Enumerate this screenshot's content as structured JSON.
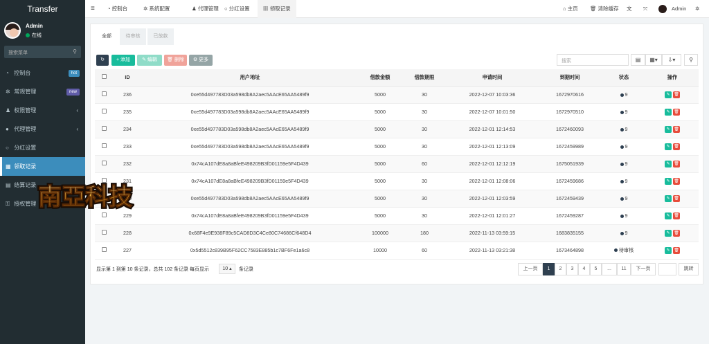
{
  "app": {
    "brand": "Transfer"
  },
  "user": {
    "name": "Admin",
    "status": "在线"
  },
  "sidebar": {
    "search_placeholder": "搜索菜单",
    "items": [
      {
        "label": "控制台",
        "badge": "hot",
        "badge_color": "#3c8dbc",
        "icon": "dashboard-icon"
      },
      {
        "label": "常规管理",
        "badge": "new",
        "badge_color": "#605ca8",
        "icon": "cogs-icon"
      },
      {
        "label": "权限管理",
        "chevron": "‹",
        "icon": "users-icon"
      },
      {
        "label": "代理管理",
        "chevron": "‹",
        "icon": "user-circle-icon"
      },
      {
        "label": "分红设置",
        "icon": "circle-icon"
      },
      {
        "label": "领取记录",
        "icon": "table-icon",
        "active": true
      },
      {
        "label": "结算记录",
        "icon": "list-icon"
      },
      {
        "label": "授权管理",
        "icon": "key-icon"
      }
    ]
  },
  "topbar": {
    "menu_icon": "≡",
    "tabs": [
      {
        "label": "控制台",
        "icon": "dashboard-icon"
      },
      {
        "label": "系统配置",
        "icon": "gear-icon"
      },
      {
        "label": "代理管理",
        "icon": "user-icon"
      },
      {
        "label": "分红设置",
        "icon": "circle-icon"
      },
      {
        "label": "领取记录",
        "icon": "table-icon",
        "active": true
      }
    ],
    "home": "主页",
    "clear_cache": "清除缓存",
    "username": "Admin"
  },
  "content_tabs": [
    "全部",
    "待审核",
    "已放款"
  ],
  "toolbar": {
    "refresh": "↻",
    "add": "+ 添加",
    "edit": "✎ 编辑",
    "delete": "🗑 删除",
    "more": "⚙ 更多",
    "search_placeholder": "搜索"
  },
  "table": {
    "headers": [
      "",
      "ID",
      "用户地址",
      "借款金额",
      "借款期限",
      "申请时间",
      "到期时间",
      "状态",
      "操作"
    ],
    "rows": [
      {
        "id": "236",
        "addr": "0xe55d497783D03a598db8A2aec5AAcE65AA5489f9",
        "amount": "5000",
        "term": "30",
        "apply": "2022-12-07 10:03:36",
        "due": "1672970616",
        "status": "9"
      },
      {
        "id": "235",
        "addr": "0xe55d497783D03a598db8A2aec5AAcE65AA5489f9",
        "amount": "5000",
        "term": "30",
        "apply": "2022-12-07 10:01:50",
        "due": "1672970510",
        "status": "9"
      },
      {
        "id": "234",
        "addr": "0xe55d497783D03a598db8A2aec5AAcE65AA5489f9",
        "amount": "5000",
        "term": "30",
        "apply": "2022-12-01 12:14:53",
        "due": "1672460093",
        "status": "9"
      },
      {
        "id": "233",
        "addr": "0xe55d497783D03a598db8A2aec5AAcE65AA5489f9",
        "amount": "5000",
        "term": "30",
        "apply": "2022-12-01 12:13:09",
        "due": "1672459989",
        "status": "9"
      },
      {
        "id": "232",
        "addr": "0x74cA107dE8a8aBfeE498209B3fD01159e5F4D439",
        "amount": "5000",
        "term": "60",
        "apply": "2022-12-01 12:12:19",
        "due": "1675051939",
        "status": "9"
      },
      {
        "id": "231",
        "addr": "0x74cA107dE8a8aBfeE498209B3fD01159e5F4D439",
        "amount": "5000",
        "term": "30",
        "apply": "2022-12-01 12:08:06",
        "due": "1672459686",
        "status": "9"
      },
      {
        "id": "230",
        "addr": "0xe55d497783D03a598db8A2aec5AAcE65AA5489f9",
        "amount": "5000",
        "term": "30",
        "apply": "2022-12-01 12:03:59",
        "due": "1672459439",
        "status": "9"
      },
      {
        "id": "229",
        "addr": "0x74cA107dE8a8aBfeE498209B3fD01159e5F4D439",
        "amount": "5000",
        "term": "30",
        "apply": "2022-12-01 12:01:27",
        "due": "1672459287",
        "status": "9"
      },
      {
        "id": "228",
        "addr": "0x68F4e9E938F89c5CAD8D3C4Ce80C74686Cf648D4",
        "amount": "100000",
        "term": "180",
        "apply": "2022-11-13 03:59:15",
        "due": "1683835155",
        "status": "9"
      },
      {
        "id": "227",
        "addr": "0x5d5512c839B95F62CC7583E885b1c7BF6Fe1a6c8",
        "amount": "10000",
        "term": "60",
        "apply": "2022-11-13 03:21:38",
        "due": "1673464898",
        "status": "待审核"
      }
    ]
  },
  "footer": {
    "info": "显示第 1 到第 10 条记录，总共 102 条记录 每页显示",
    "page_size": "10 ▴",
    "suffix": "条记录",
    "prev": "上一页",
    "pages": [
      "1",
      "2",
      "3",
      "4",
      "5",
      "...",
      "11"
    ],
    "next": "下一页",
    "jump": "跳转"
  },
  "watermark": "南亚科技"
}
